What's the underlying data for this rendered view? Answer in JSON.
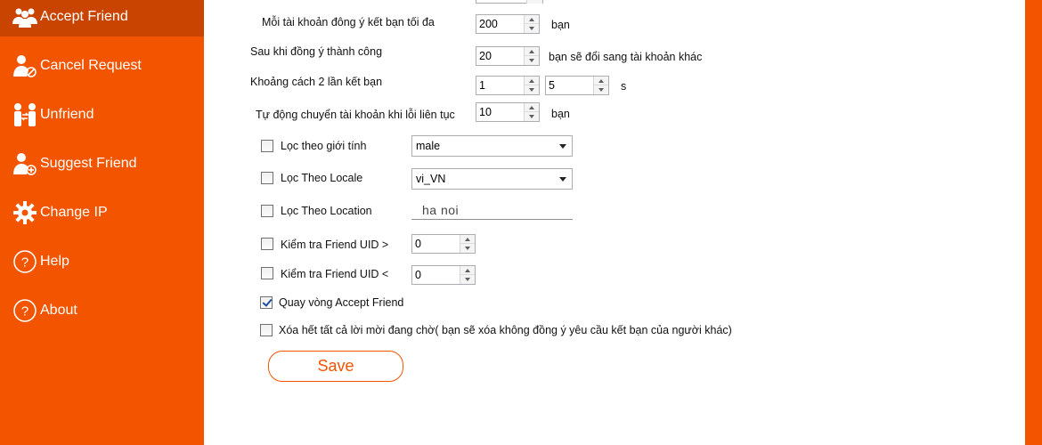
{
  "sidebar": {
    "items": [
      {
        "label": "Accept Friend",
        "icon": "group-users-icon",
        "active": true
      },
      {
        "label": "Cancel Request",
        "icon": "user-cancel-icon"
      },
      {
        "label": "Unfriend",
        "icon": "users-unfriend-icon"
      },
      {
        "label": "Suggest Friend",
        "icon": "user-add-icon"
      },
      {
        "label": "Change IP",
        "icon": "gear-icon"
      },
      {
        "label": "Help",
        "icon": "question-circle-icon"
      },
      {
        "label": "About",
        "icon": "question-circle-icon"
      }
    ]
  },
  "form": {
    "max_accept": {
      "label": "Mỗi tài khoản đông ý kết bạn tối đa",
      "value": "200",
      "unit": "bạn"
    },
    "after_success": {
      "label": "Sau khi đồng ý thành công",
      "value": "20",
      "unit": "bạn sẽ đổi sang tài khoản khác"
    },
    "interval": {
      "label": "Khoảng cách 2 lần kết bạn",
      "min": "1",
      "max": "5",
      "unit": "s"
    },
    "auto_switch": {
      "label": "Tự động chuyển tài khoản khi lỗi liên tục",
      "value": "10",
      "unit": "bạn"
    },
    "filter_gender": {
      "label": "Lọc theo giới tính",
      "checked": false,
      "value": "male"
    },
    "filter_locale": {
      "label": "Lọc Theo Locale",
      "checked": false,
      "value": "vi_VN"
    },
    "filter_location": {
      "label": "Lọc Theo Location",
      "checked": false,
      "value": "ha noi"
    },
    "uid_gt": {
      "label": "Kiểm tra Friend UID >",
      "checked": false,
      "value": "0"
    },
    "uid_lt": {
      "label": "Kiểm tra Friend UID <",
      "checked": false,
      "value": "0"
    },
    "rotate": {
      "label": "Quay vòng Accept Friend",
      "checked": true
    },
    "clear_pending": {
      "label": "Xóa hết tất cả lời mời đang chờ( bạn sẽ xóa không đồng ý yêu cầu kết bạn của người khác)",
      "checked": false
    },
    "save_label": "Save"
  },
  "colors": {
    "accent": "#f25400",
    "active_nav": "#c94400"
  }
}
